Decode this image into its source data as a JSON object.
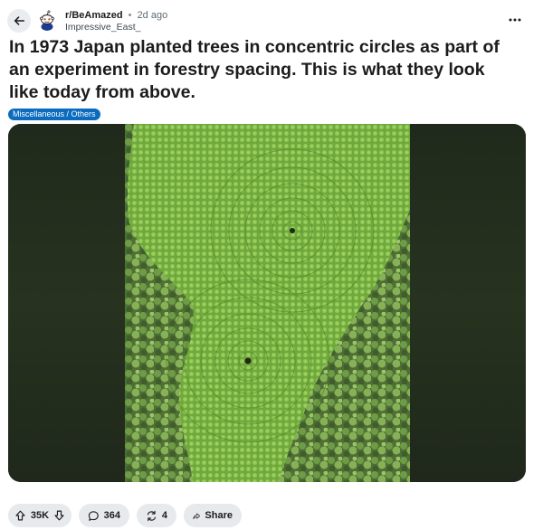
{
  "header": {
    "subreddit": "r/BeAmazed",
    "separator": "•",
    "age": "2d ago",
    "author": "Impressive_East_"
  },
  "post": {
    "title": "In 1973 Japan planted trees in concentric circles as part of an experiment in forestry spacing. This is what they look like today from above.",
    "flair": "Miscellaneous / Others"
  },
  "actions": {
    "upvotes": "35K",
    "comments": "364",
    "crossposts": "4",
    "share_label": "Share"
  },
  "icons": {
    "back": "arrow-left-icon",
    "more": "ellipsis-icon",
    "upvote": "arrow-up-icon",
    "downvote": "arrow-down-icon",
    "comment": "speech-bubble-icon",
    "crosspost": "crosspost-arrows-icon",
    "share": "share-arrow-icon"
  },
  "colors": {
    "flair_bg": "#0a6bbf",
    "pill_bg": "#e6eaec",
    "back_btn_bg": "#eaedef"
  }
}
